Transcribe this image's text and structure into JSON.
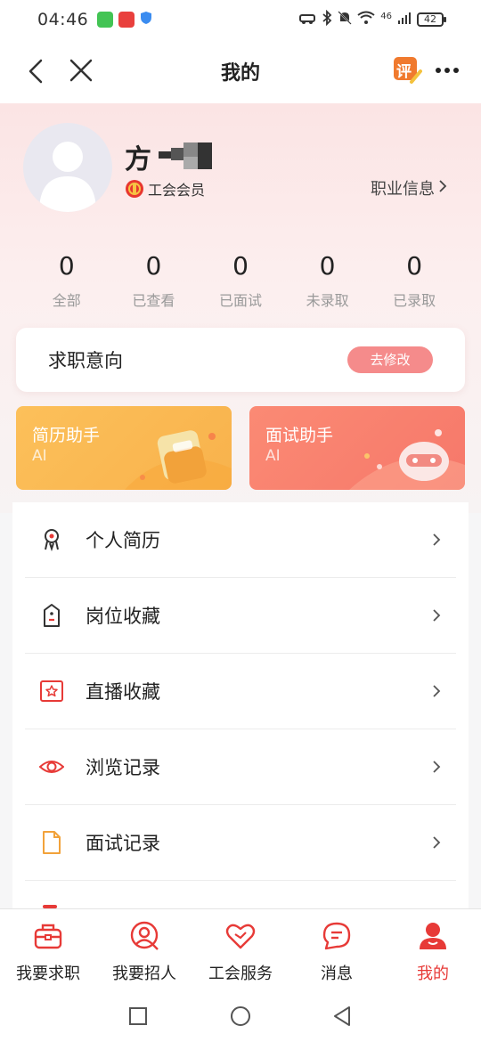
{
  "status_bar": {
    "time": "04:46",
    "battery": "42",
    "network": "46"
  },
  "nav": {
    "title": "我的",
    "rate_badge": "评"
  },
  "profile": {
    "name": "方",
    "member_label": "工会会员",
    "career_link": "职业信息",
    "career_chevron": "›"
  },
  "stats": [
    {
      "value": "0",
      "label": "全部"
    },
    {
      "value": "0",
      "label": "已查看"
    },
    {
      "value": "0",
      "label": "已面试"
    },
    {
      "value": "0",
      "label": "未录取"
    },
    {
      "value": "0",
      "label": "已录取"
    }
  ],
  "intent": {
    "title": "求职意向",
    "action": "去修改"
  },
  "assistants": [
    {
      "title": "简历助手",
      "sub": "AI"
    },
    {
      "title": "面试助手",
      "sub": "AI"
    }
  ],
  "menu": [
    {
      "label": "个人简历",
      "icon": "resume-icon"
    },
    {
      "label": "岗位收藏",
      "icon": "bookmark-icon"
    },
    {
      "label": "直播收藏",
      "icon": "live-star-icon"
    },
    {
      "label": "浏览记录",
      "icon": "eye-icon"
    },
    {
      "label": "面试记录",
      "icon": "document-icon"
    }
  ],
  "tabs": [
    {
      "label": "我要求职",
      "icon": "briefcase-icon"
    },
    {
      "label": "我要招人",
      "icon": "recruit-icon"
    },
    {
      "label": "工会服务",
      "icon": "heart-icon"
    },
    {
      "label": "消息",
      "icon": "message-icon"
    },
    {
      "label": "我的",
      "icon": "user-icon",
      "active": true
    }
  ],
  "colors": {
    "accent": "#e73a37",
    "intent_button": "#f58b8b",
    "resume_card": "#fcc05a",
    "interview_card": "#fb8a74",
    "header_bg": "#fbe4e4"
  }
}
